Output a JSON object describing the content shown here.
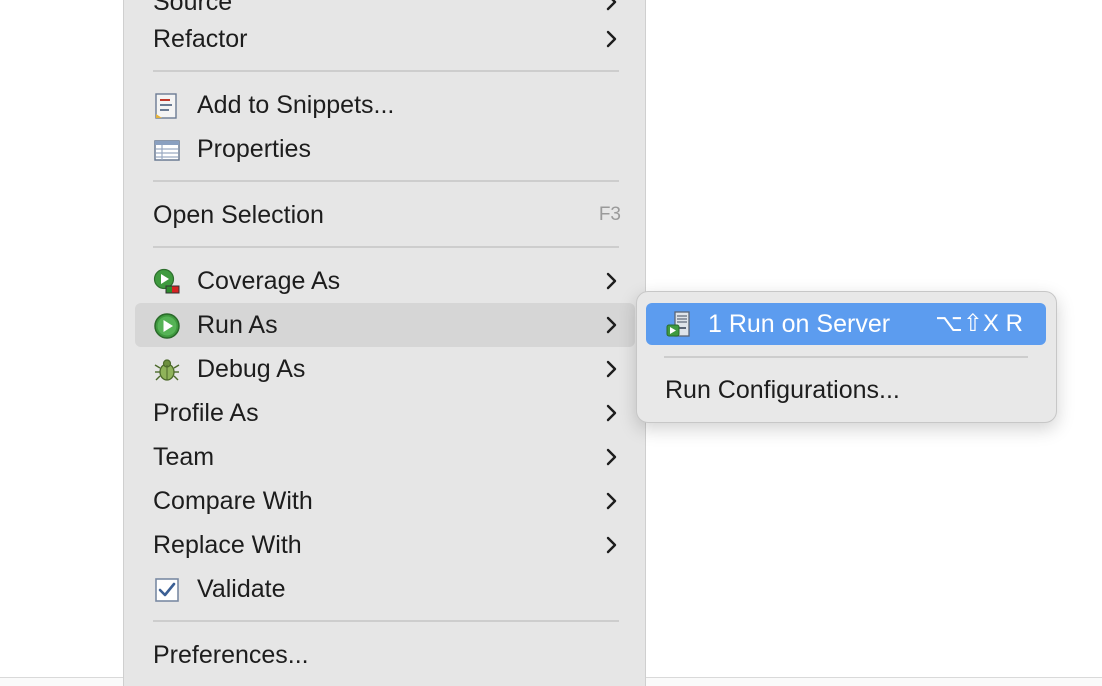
{
  "menu": {
    "items": {
      "source": {
        "label": "Source",
        "has_submenu": true
      },
      "refactor": {
        "label": "Refactor",
        "has_submenu": true
      },
      "add_snippets": {
        "label": "Add to Snippets...",
        "icon": "snippets-icon"
      },
      "properties": {
        "label": "Properties",
        "icon": "properties-icon"
      },
      "open_selection": {
        "label": "Open Selection",
        "shortcut": "F3"
      },
      "coverage_as": {
        "label": "Coverage As",
        "icon": "coverage-icon",
        "has_submenu": true
      },
      "run_as": {
        "label": "Run As",
        "icon": "run-icon",
        "has_submenu": true,
        "highlighted": true
      },
      "debug_as": {
        "label": "Debug As",
        "icon": "bug-icon",
        "has_submenu": true
      },
      "profile_as": {
        "label": "Profile As",
        "has_submenu": true
      },
      "team": {
        "label": "Team",
        "has_submenu": true
      },
      "compare_with": {
        "label": "Compare With",
        "has_submenu": true
      },
      "replace_with": {
        "label": "Replace With",
        "has_submenu": true
      },
      "validate": {
        "label": "Validate",
        "icon": "checkbox-icon"
      },
      "preferences": {
        "label": "Preferences..."
      }
    }
  },
  "submenu": {
    "run_on_server": {
      "label": "1 Run on Server",
      "shortcut": "⌥⇧X R",
      "icon": "server-icon",
      "selected": true
    },
    "run_configurations": {
      "label": "Run Configurations..."
    }
  },
  "colors": {
    "menu_bg": "#e6e6e6",
    "hover_bg": "#d6d6d6",
    "selection_blue": "#5c9cef",
    "separator": "#cdcdcd"
  }
}
